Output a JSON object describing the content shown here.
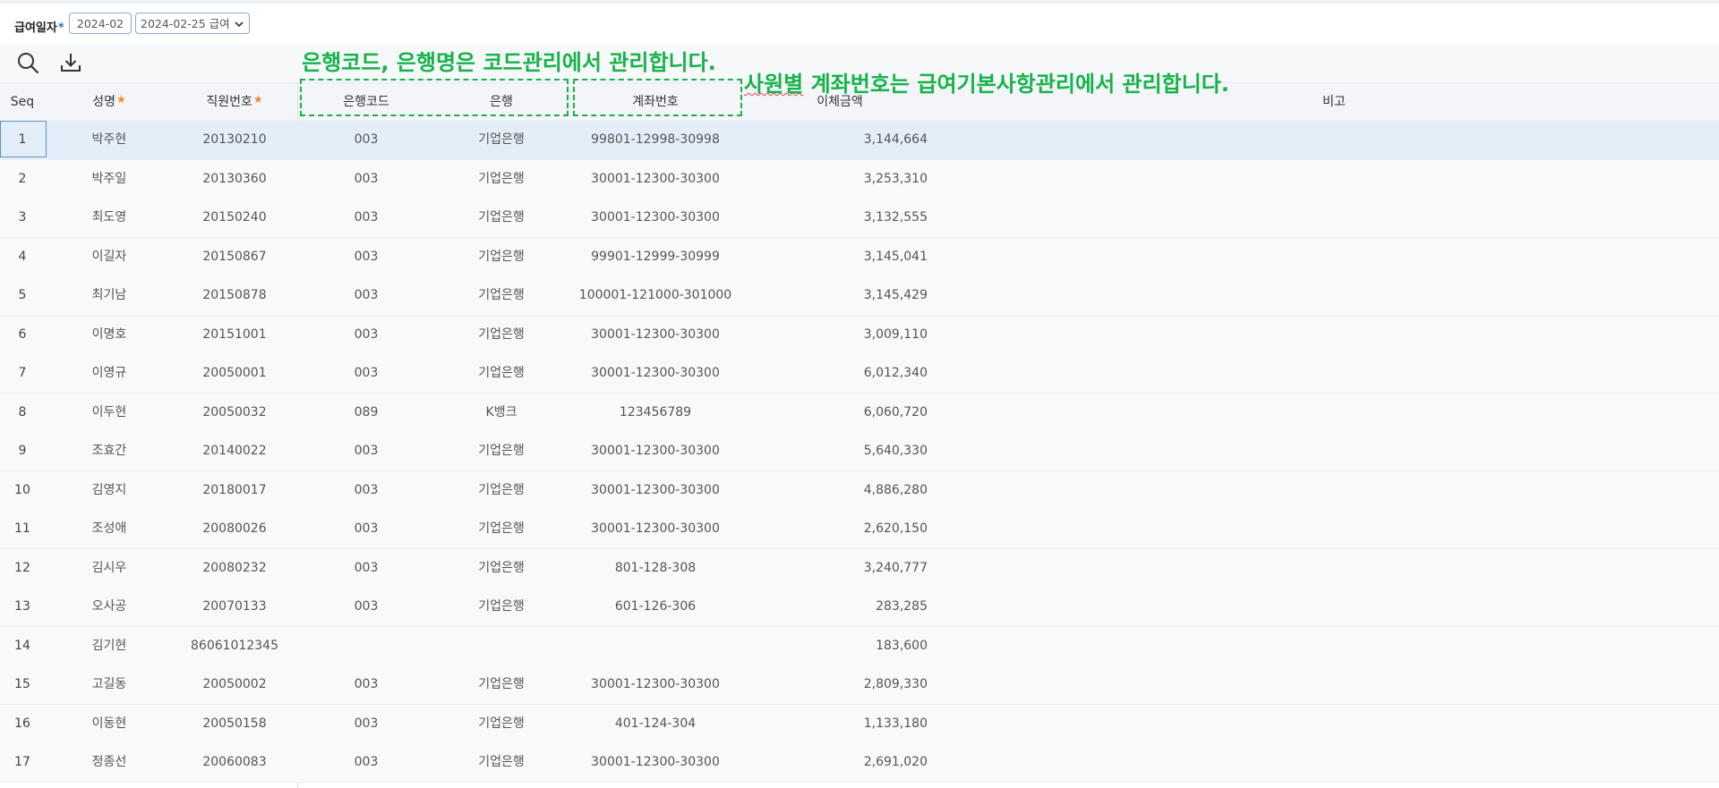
{
  "filter": {
    "label": "급여일자",
    "required_mark": "*",
    "month": "2024-02",
    "pay_date": "2024-02-25 급여",
    "dropdown_icon": "chevron-down-icon"
  },
  "toolbar": {
    "search_icon": "search-icon",
    "download_icon": "download-icon"
  },
  "annotations": {
    "bank_note": "은행코드, 은행명은 코드관리에서 관리합니다.",
    "account_note_prefix": "사원별",
    "account_note_rest": " 계좌번호는 급여기본사항관리에서 관리합니다.",
    "accent_color": "#16b34a"
  },
  "columns": {
    "seq": "Seq",
    "name": "성명",
    "emp_no": "직원번호",
    "bank_code": "은행코드",
    "bank": "은행",
    "account": "계좌번호",
    "amount": "이체금액",
    "note": "비고",
    "required_mark": "★"
  },
  "rows": [
    {
      "seq": "1",
      "name": "박주현",
      "emp_no": "20130210",
      "bank_code": "003",
      "bank": "기업은행",
      "account": "99801-12998-30998",
      "amount": "3,144,664",
      "selected": true
    },
    {
      "seq": "2",
      "name": "박주일",
      "emp_no": "20130360",
      "bank_code": "003",
      "bank": "기업은행",
      "account": "30001-12300-30300",
      "amount": "3,253,310"
    },
    {
      "seq": "3",
      "name": "최도영",
      "emp_no": "20150240",
      "bank_code": "003",
      "bank": "기업은행",
      "account": "30001-12300-30300",
      "amount": "3,132,555"
    },
    {
      "seq": "4",
      "name": "이길자",
      "emp_no": "20150867",
      "bank_code": "003",
      "bank": "기업은행",
      "account": "99901-12999-30999",
      "amount": "3,145,041"
    },
    {
      "seq": "5",
      "name": "최기남",
      "emp_no": "20150878",
      "bank_code": "003",
      "bank": "기업은행",
      "account": "100001-121000-301000",
      "amount": "3,145,429"
    },
    {
      "seq": "6",
      "name": "이명호",
      "emp_no": "20151001",
      "bank_code": "003",
      "bank": "기업은행",
      "account": "30001-12300-30300",
      "amount": "3,009,110"
    },
    {
      "seq": "7",
      "name": "이영규",
      "emp_no": "20050001",
      "bank_code": "003",
      "bank": "기업은행",
      "account": "30001-12300-30300",
      "amount": "6,012,340"
    },
    {
      "seq": "8",
      "name": "이두현",
      "emp_no": "20050032",
      "bank_code": "089",
      "bank": "K뱅크",
      "account": "123456789",
      "amount": "6,060,720"
    },
    {
      "seq": "9",
      "name": "조효간",
      "emp_no": "20140022",
      "bank_code": "003",
      "bank": "기업은행",
      "account": "30001-12300-30300",
      "amount": "5,640,330"
    },
    {
      "seq": "10",
      "name": "김영지",
      "emp_no": "20180017",
      "bank_code": "003",
      "bank": "기업은행",
      "account": "30001-12300-30300",
      "amount": "4,886,280"
    },
    {
      "seq": "11",
      "name": "조성애",
      "emp_no": "20080026",
      "bank_code": "003",
      "bank": "기업은행",
      "account": "30001-12300-30300",
      "amount": "2,620,150"
    },
    {
      "seq": "12",
      "name": "김시우",
      "emp_no": "20080232",
      "bank_code": "003",
      "bank": "기업은행",
      "account": "801-128-308",
      "amount": "3,240,777"
    },
    {
      "seq": "13",
      "name": "오사공",
      "emp_no": "20070133",
      "bank_code": "003",
      "bank": "기업은행",
      "account": "601-126-306",
      "amount": "283,285"
    },
    {
      "seq": "14",
      "name": "김기현",
      "emp_no": "86061012345",
      "bank_code": "",
      "bank": "",
      "account": "",
      "amount": "183,600"
    },
    {
      "seq": "15",
      "name": "고길동",
      "emp_no": "20050002",
      "bank_code": "003",
      "bank": "기업은행",
      "account": "30001-12300-30300",
      "amount": "2,809,330"
    },
    {
      "seq": "16",
      "name": "이동현",
      "emp_no": "20050158",
      "bank_code": "003",
      "bank": "기업은행",
      "account": "401-124-304",
      "amount": "1,133,180"
    },
    {
      "seq": "17",
      "name": "정종선",
      "emp_no": "20060083",
      "bank_code": "003",
      "bank": "기업은행",
      "account": "30001-12300-30300",
      "amount": "2,691,020"
    }
  ]
}
